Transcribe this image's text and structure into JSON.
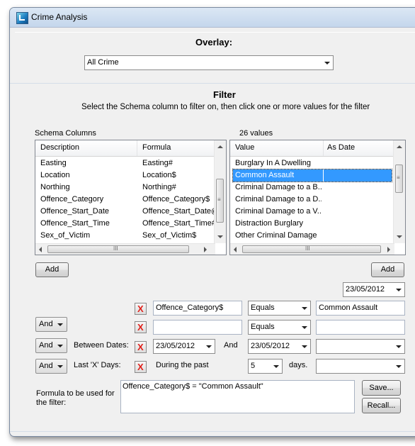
{
  "window": {
    "title": "Crime Analysis"
  },
  "overlay": {
    "label": "Overlay:",
    "selected": "All Crime"
  },
  "filter": {
    "heading": "Filter",
    "instruction": "Select the Schema column to filter on, then click one or more values for the filter",
    "schema_label": "Schema Columns",
    "values_label": "26 values",
    "schema_list": {
      "headers": [
        "Description",
        "Formula"
      ],
      "rows": [
        [
          "Easting",
          "Easting#"
        ],
        [
          "Location",
          "Location$"
        ],
        [
          "Northing",
          "Northing#"
        ],
        [
          "Offence_Category",
          "Offence_Category$"
        ],
        [
          "Offence_Start_Date",
          "Offence_Start_Date@"
        ],
        [
          "Offence_Start_Time",
          "Offence_Start_Time#"
        ],
        [
          "Sex_of_Victim",
          "Sex_of_Victim$"
        ]
      ]
    },
    "values_list": {
      "headers": [
        "Value",
        "As Date"
      ],
      "rows": [
        [
          "Burglary In A Dwelling",
          ""
        ],
        [
          "Common Assault",
          ""
        ],
        [
          "Criminal Damage to a B...",
          ""
        ],
        [
          "Criminal Damage to a D...",
          ""
        ],
        [
          "Criminal Damage to a V...",
          ""
        ],
        [
          "Distraction Burglary",
          ""
        ],
        [
          "Other Criminal Damage",
          ""
        ]
      ],
      "selected_index": 1
    },
    "add_left": "Add",
    "add_right": "Add",
    "date_picker": "23/05/2012",
    "row1": {
      "column": "Offence_Category$",
      "operator": "Equals",
      "value": "Common Assault"
    },
    "row2": {
      "conj": "And",
      "column": "",
      "operator": "Equals",
      "value": ""
    },
    "row3": {
      "conj": "And",
      "label": "Between Dates:",
      "from": "23/05/2012",
      "and_label": "And",
      "to": "23/05/2012",
      "extra": ""
    },
    "row4": {
      "conj": "And",
      "label": "Last 'X' Days:",
      "during": "During the past",
      "days_value": "5",
      "days_label": "days.",
      "extra": ""
    },
    "formula_label": "Formula to be used for the filter:",
    "formula_text": "Offence_Category$ = \"Common Assault\"",
    "save": "Save...",
    "recall": "Recall...",
    "remove_icon_glyph": "X"
  }
}
